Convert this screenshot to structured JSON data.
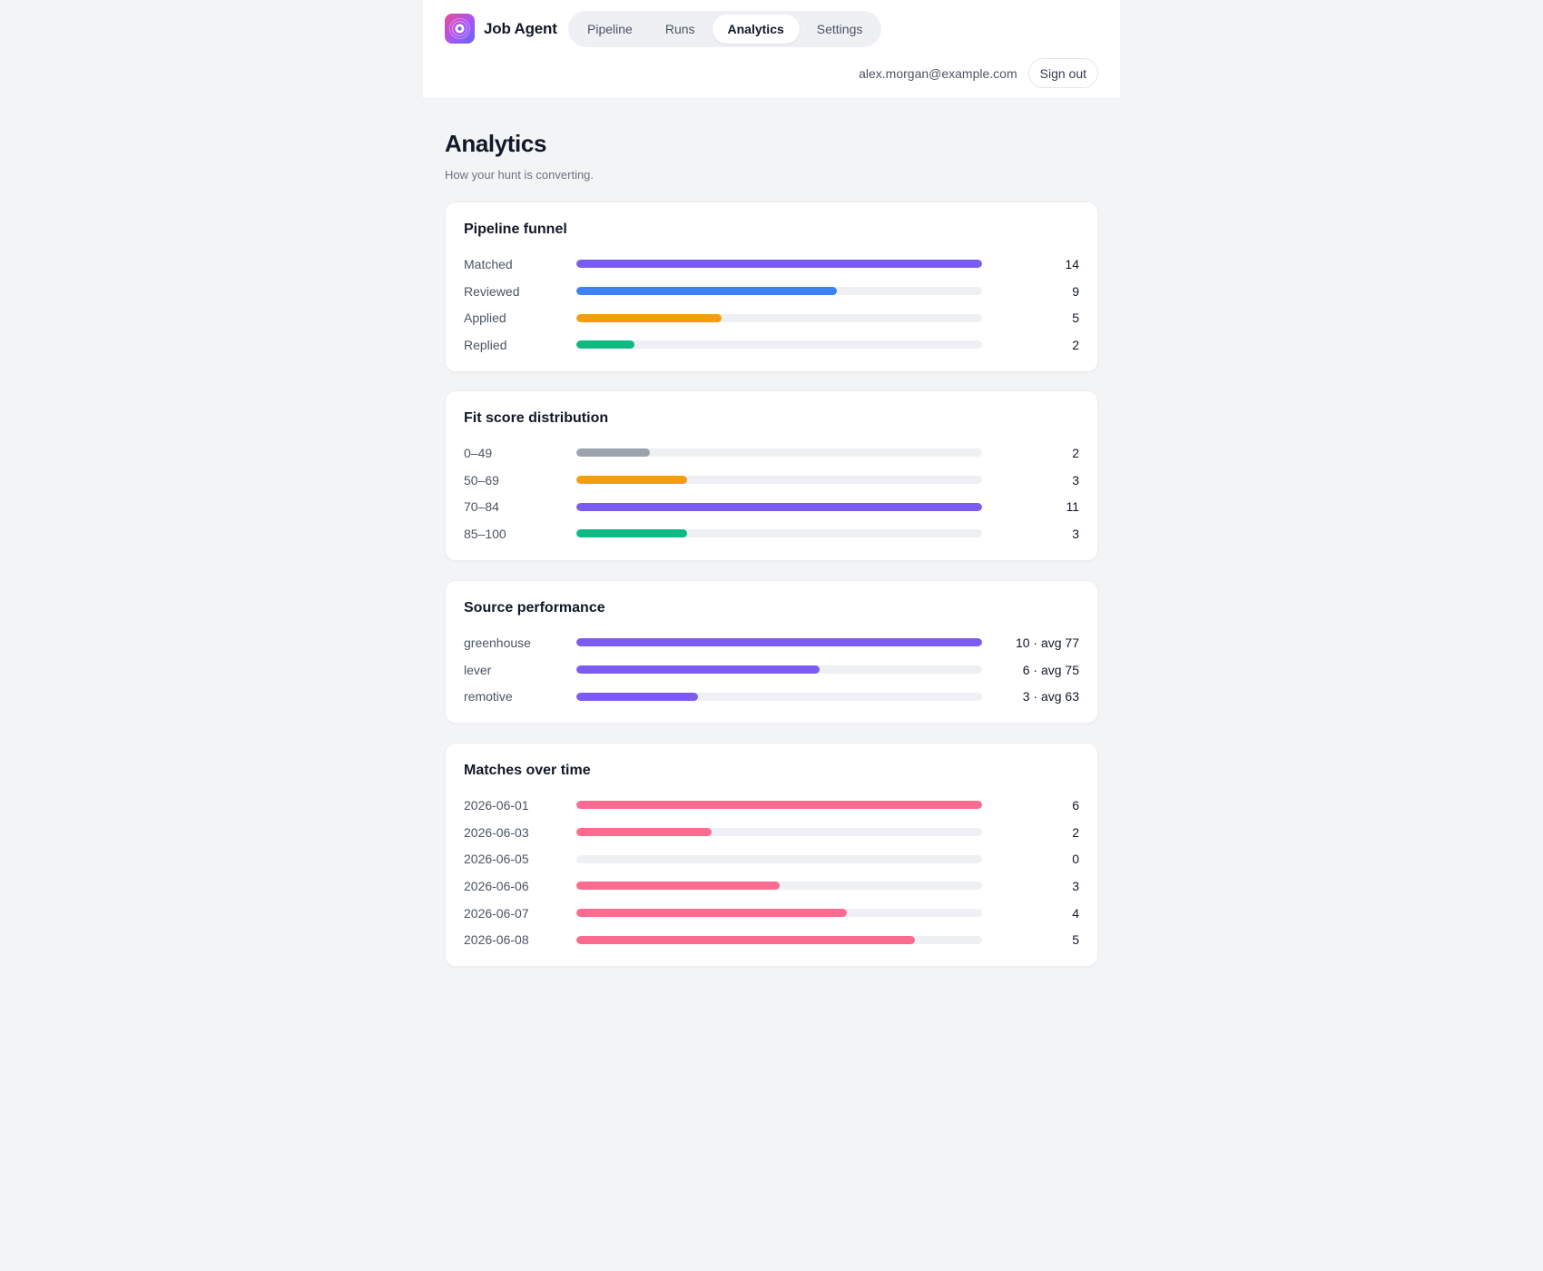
{
  "app": {
    "name": "Job Agent",
    "logo_icon": "target-icon"
  },
  "nav": {
    "tabs": [
      {
        "label": "Pipeline",
        "active": false
      },
      {
        "label": "Runs",
        "active": false
      },
      {
        "label": "Analytics",
        "active": true
      },
      {
        "label": "Settings",
        "active": false
      }
    ]
  },
  "user": {
    "email": "alex.morgan@example.com",
    "sign_out_label": "Sign out"
  },
  "page": {
    "title": "Analytics",
    "subtitle": "How your hunt is converting."
  },
  "colors": {
    "purple": "#7c5cf0",
    "blue": "#3b82f6",
    "orange": "#f59e0b",
    "green": "#10b981",
    "gray": "#9ca3af",
    "pink": "#fb6a8f",
    "track": "#eef0f3"
  },
  "chart_data": [
    {
      "type": "bar",
      "title": "Pipeline funnel",
      "categories": [
        "Matched",
        "Reviewed",
        "Applied",
        "Replied"
      ],
      "values": [
        14,
        9,
        5,
        2
      ],
      "display_values": [
        "14",
        "9",
        "5",
        "2"
      ],
      "colors": [
        "#7c5cf0",
        "#3b82f6",
        "#f59e0b",
        "#10b981"
      ]
    },
    {
      "type": "bar",
      "title": "Fit score distribution",
      "categories": [
        "0–49",
        "50–69",
        "70–84",
        "85–100"
      ],
      "values": [
        2,
        3,
        11,
        3
      ],
      "display_values": [
        "2",
        "3",
        "11",
        "3"
      ],
      "colors": [
        "#9ca3af",
        "#f59e0b",
        "#7c5cf0",
        "#10b981"
      ]
    },
    {
      "type": "bar",
      "title": "Source performance",
      "categories": [
        "greenhouse",
        "lever",
        "remotive"
      ],
      "values": [
        10,
        6,
        3
      ],
      "averages": [
        77,
        75,
        63
      ],
      "display_values": [
        "10 · avg 77",
        "6 · avg 75",
        "3 · avg 63"
      ],
      "colors": [
        "#7c5cf0",
        "#7c5cf0",
        "#7c5cf0"
      ]
    },
    {
      "type": "bar",
      "title": "Matches over time",
      "categories": [
        "2026-06-01",
        "2026-06-03",
        "2026-06-05",
        "2026-06-06",
        "2026-06-07",
        "2026-06-08"
      ],
      "values": [
        6,
        2,
        0,
        3,
        4,
        5
      ],
      "display_values": [
        "6",
        "2",
        "0",
        "3",
        "4",
        "5"
      ],
      "colors": [
        "#fb6a8f",
        "#fb6a8f",
        "#fb6a8f",
        "#fb6a8f",
        "#fb6a8f",
        "#fb6a8f"
      ]
    }
  ]
}
